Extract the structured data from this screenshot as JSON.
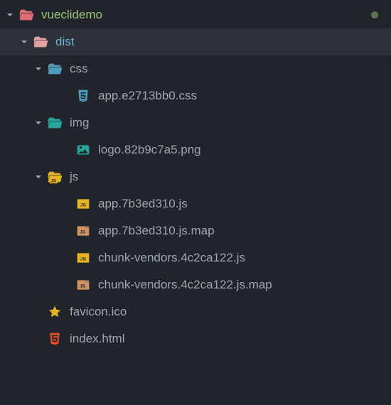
{
  "root": {
    "name": "vueclidemo",
    "status": "modified"
  },
  "tree": {
    "dist": {
      "label": "dist",
      "children": {
        "css": {
          "label": "css",
          "files": [
            {
              "label": "app.e2713bb0.css"
            }
          ]
        },
        "img": {
          "label": "img",
          "files": [
            {
              "label": "logo.82b9c7a5.png"
            }
          ]
        },
        "js": {
          "label": "js",
          "files": [
            {
              "label": "app.7b3ed310.js"
            },
            {
              "label": "app.7b3ed310.js.map"
            },
            {
              "label": "chunk-vendors.4c2ca122.js"
            },
            {
              "label": "chunk-vendors.4c2ca122.js.map"
            }
          ]
        },
        "rootFiles": [
          {
            "label": "favicon.ico"
          },
          {
            "label": "index.html"
          }
        ]
      }
    }
  }
}
